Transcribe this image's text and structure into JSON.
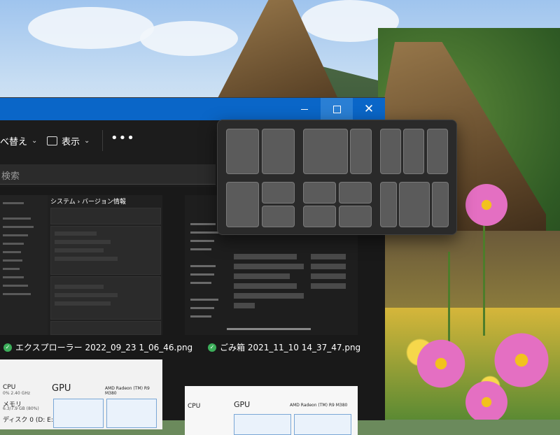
{
  "window": {
    "caption": {
      "minimize_icon": "minimize-icon",
      "maximize_icon": "maximize-icon",
      "close_icon": "close-icon",
      "accent": "#0a66c8"
    },
    "toolbar": {
      "sort_label": "べ替え",
      "view_label": "表示",
      "more_label": "•••"
    },
    "search": {
      "placeholder": "検索"
    },
    "files": [
      {
        "name": "エクスプローラー 2022_09_23 1_06_46.png",
        "status": "synced"
      },
      {
        "name": "ごみ箱 2021_11_10 14_37_47.png",
        "status": "synced"
      }
    ],
    "thumb1": {
      "header": "システム › バージョン情報"
    },
    "thumb3": {
      "gpu_label": "GPU",
      "gpu_name": "AMD Radeon (TM) R9 M380",
      "cpu_label": "CPU",
      "cpu_value": "0% 2.40 GHz",
      "memory_label": "メモリ",
      "memory_value": "6.3/7.9 GB (80%)",
      "disk_label": "ディスク 0 (D: E:)"
    },
    "thumb4": {
      "gpu_label": "GPU",
      "gpu_name": "AMD Radeon (TM) R9 M380",
      "cpu_label": "CPU"
    }
  },
  "snap_layouts": {
    "zone_color": "#5b5b5b",
    "layouts": [
      "two-equal",
      "wide-narrow",
      "three-columns",
      "left-half-right-stack",
      "four-grid",
      "narrow-wide-narrow"
    ]
  }
}
